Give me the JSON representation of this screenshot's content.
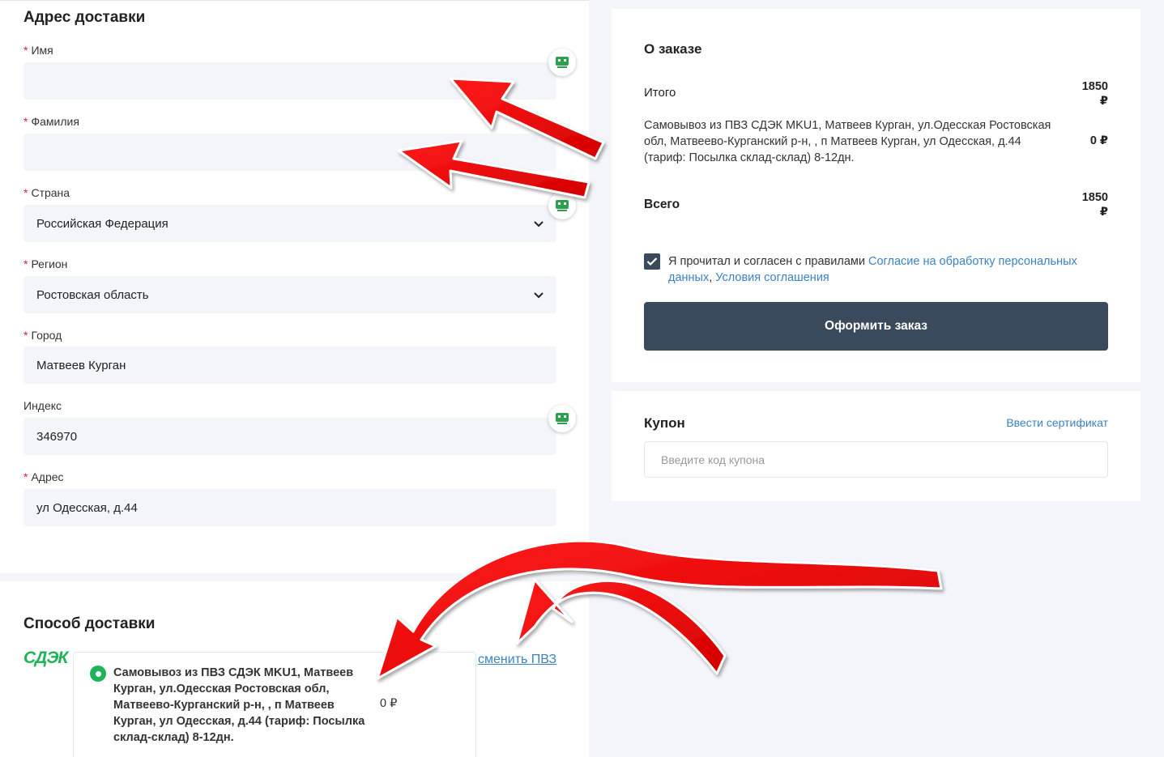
{
  "address": {
    "title": "Адрес доставки",
    "fields": [
      {
        "label": "Имя",
        "required": true,
        "value": ""
      },
      {
        "label": "Фамилия",
        "required": true,
        "value": ""
      },
      {
        "label": "Страна",
        "required": true,
        "value": "Российская Федерация"
      },
      {
        "label": "Регион",
        "required": true,
        "value": "Ростовская область"
      },
      {
        "label": "Город",
        "required": true,
        "value": "Матвеев Курган"
      },
      {
        "label": "Индекс",
        "required": false,
        "value": "346970"
      },
      {
        "label": "Адрес",
        "required": true,
        "value": "ул Одесская, д.44"
      }
    ]
  },
  "delivery": {
    "title": "Способ доставки",
    "logo": "СДЭК",
    "change_link": "сменить ПВЗ",
    "option_text": "Самовывоз из ПВЗ СДЭК MKU1, Матвеев Курган, ул.Одесская Ростовская обл, Матвеево-Курганский р-н, , п Матвеев Курган, ул Одесская, д.44 (тариф: Посылка склад-склад) 8-12дн.",
    "option_price": "0 ₽"
  },
  "order": {
    "title": "О заказе",
    "itogo_label": "Итого",
    "itogo_value": "1850",
    "currency": "₽",
    "shipping_text": "Самовывоз из ПВЗ СДЭК MKU1, Матвеев Курган, ул.Одесская Ростовская обл, Матвеево-Курганский р-н, , п Матвеев Курган, ул Одесская, д.44 (тариф: Посылка склад-склад) 8-12дн.",
    "shipping_price": "0 ₽",
    "total_label": "Всего",
    "total_value": "1850",
    "agree_prefix": "Я прочитал и согласен с правилами ",
    "agree_link1": "Согласие на обработку персональных данных",
    "agree_sep": ", ",
    "agree_link2": "Условия соглашения",
    "agree_checked": true,
    "submit_label": "Оформить заказ"
  },
  "coupon": {
    "title": "Купон",
    "cert_link": "Ввести сертификат",
    "placeholder": "Введите код купона"
  },
  "colors": {
    "accent": "#394a5c",
    "link": "#3b82c4",
    "cdek_green": "#1fb45a",
    "required": "#e0202a",
    "annotation_arrow": "#ff0000"
  },
  "icons": {
    "helper_badge": "password-manager-icon",
    "select_chevron": "chevron-down-icon",
    "checkbox": "checkmark-icon"
  }
}
